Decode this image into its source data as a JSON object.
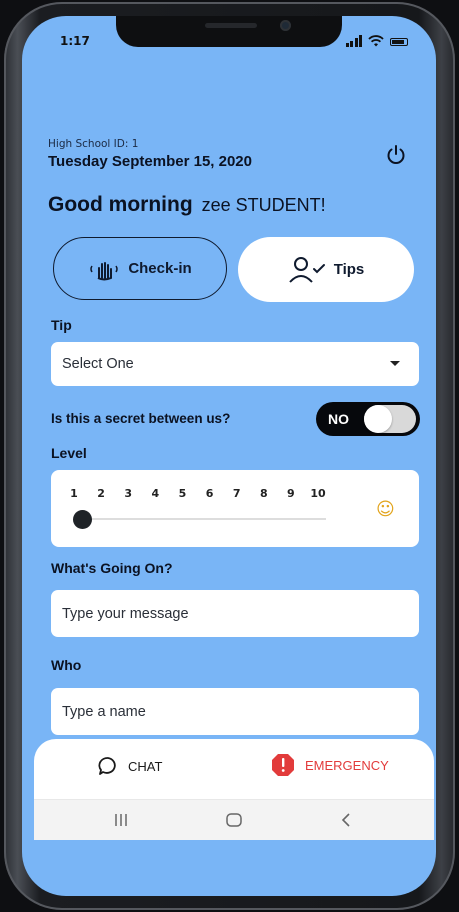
{
  "status": {
    "time": "1:17"
  },
  "header": {
    "school_id": "High School ID: 1",
    "date": "Tuesday September 15, 2020",
    "greeting": "Good morning",
    "user_name": "zee STUDENT!"
  },
  "mode_buttons": {
    "checkin_label": "Check-in",
    "tips_label": "Tips"
  },
  "form": {
    "tip_label": "Tip",
    "tip_select_value": "Select One",
    "secret_label": "Is this a secret between us?",
    "secret_toggle": "NO",
    "level_label": "Level",
    "level_ticks": [
      "1",
      "2",
      "3",
      "4",
      "5",
      "6",
      "7",
      "8",
      "9",
      "10"
    ],
    "level_value": 1,
    "whats_going_on_label": "What's Going On?",
    "message_placeholder": "Type your message",
    "who_label": "Who",
    "who_placeholder": "Type a name"
  },
  "bottom_tabs": {
    "chat_label": "CHAT",
    "emergency_label": "EMERGENCY"
  },
  "colors": {
    "background": "#79b5f6",
    "emergency": "#e23b3b",
    "toggle_bg": "#06080c"
  },
  "icons": [
    "signal-icon",
    "wifi-icon",
    "battery-icon",
    "power-icon",
    "wave-hand-icon",
    "user-check-icon",
    "chevron-down-icon",
    "smile-icon",
    "chat-bubble-icon",
    "alert-octagon-icon",
    "recents-icon",
    "home-icon",
    "back-icon"
  ]
}
